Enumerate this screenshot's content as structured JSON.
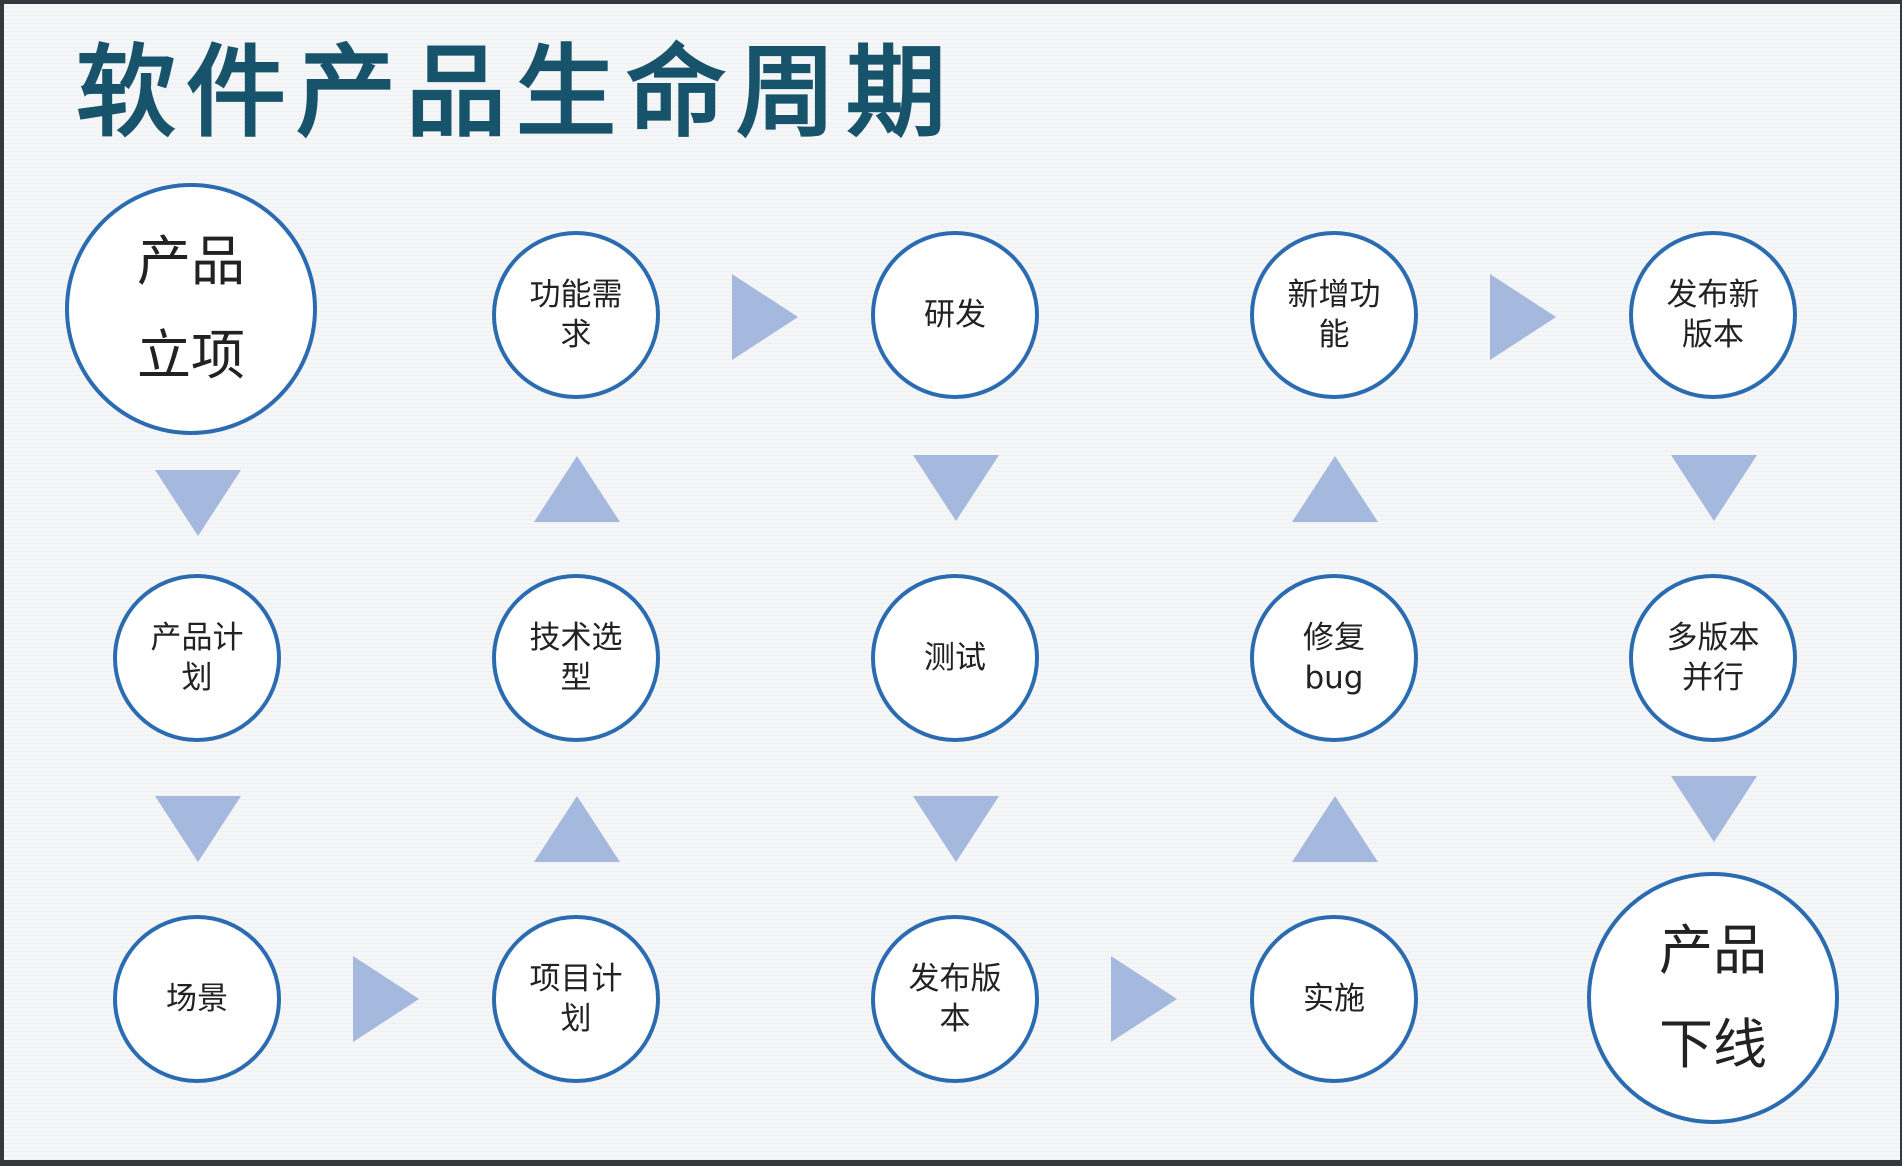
{
  "title": "软件产品生命周期",
  "nodes": {
    "product_initiation": [
      "产品",
      "立项"
    ],
    "product_plan": [
      "产品计",
      "划"
    ],
    "scenario": [
      "场景"
    ],
    "feature_requirements": [
      "功能需",
      "求"
    ],
    "tech_selection": [
      "技术选",
      "型"
    ],
    "project_plan": [
      "项目计",
      "划"
    ],
    "development": [
      "研发"
    ],
    "testing": [
      "测试"
    ],
    "release_version": [
      "发布版",
      "本"
    ],
    "new_feature": [
      "新增功",
      "能"
    ],
    "fix_bug": [
      "修复",
      "bug"
    ],
    "implementation": [
      "实施"
    ],
    "new_version_release": [
      "发布新",
      "版本"
    ],
    "parallel_versions": [
      "多版本",
      "并行"
    ],
    "product_offline": [
      "产品",
      "下线"
    ]
  },
  "colors": {
    "circle_border": "#2b6cb1",
    "arrow": "#a5b8de",
    "title": "#17536a",
    "background": "#f5f6f8"
  }
}
